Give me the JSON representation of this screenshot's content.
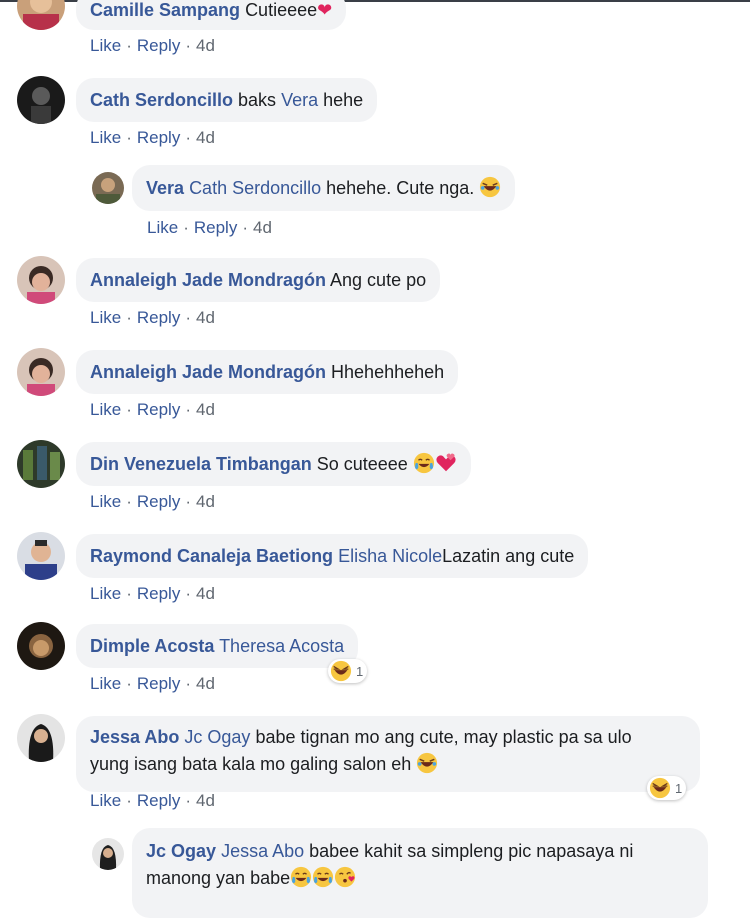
{
  "actions": {
    "like": "Like",
    "reply": "Reply",
    "dot": "·"
  },
  "comments": [
    {
      "name": "Camille Sampang",
      "text": "Cutieeee",
      "time": "4d"
    },
    {
      "name": "Cath Serdoncillo",
      "text_before": "baks ",
      "tag": "Vera",
      "text_after": " hehe",
      "time": "4d"
    },
    {
      "name": "Vera",
      "tag": "Cath Serdoncillo",
      "text_after": " hehehe. Cute nga. ",
      "time": "4d"
    },
    {
      "name": "Annaleigh Jade Mondragón",
      "text": "Ang cute po",
      "time": "4d"
    },
    {
      "name": "Annaleigh Jade Mondragón",
      "text": "Hhehehheheh",
      "time": "4d"
    },
    {
      "name": "Din Venezuela Timbangan",
      "text": "So cuteeee ",
      "time": "4d"
    },
    {
      "name": "Raymond Canaleja Baetiong",
      "tag": "Elisha Nicole",
      "text_after": "Lazatin ang cute",
      "time": "4d"
    },
    {
      "name": "Dimple Acosta",
      "tag": "Theresa Acosta",
      "time": "4d",
      "reaction_count": "1"
    },
    {
      "name": "Jessa Abo",
      "tag": "Jc Ogay",
      "text_after": " babe tignan mo ang cute, may plastic pa sa ulo",
      "line2": "yung isang bata kala mo galing salon eh ",
      "time": "4d",
      "reaction_count": "1"
    },
    {
      "name": "Jc Ogay",
      "tag": "Jessa Abo",
      "text_after": " babee kahit sa simpleng pic napasaya ni",
      "line2": "manong yan babe"
    }
  ]
}
